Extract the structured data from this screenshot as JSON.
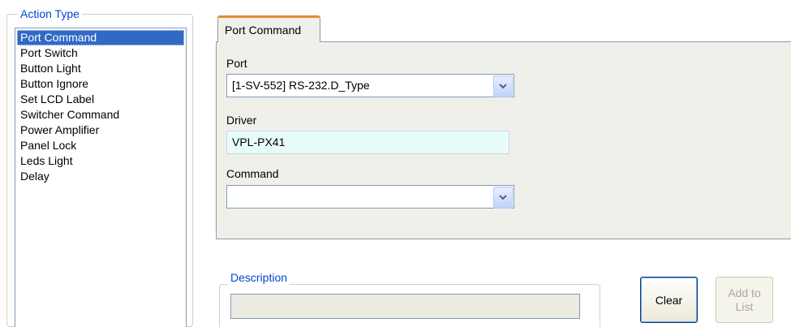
{
  "action_type": {
    "legend": "Action Type",
    "items": [
      "Port Command",
      "Port Switch",
      "Button Light",
      "Button Ignore",
      "Set LCD Label",
      "Switcher Command",
      "Power Amplifier",
      "Panel Lock",
      "Leds Light",
      "Delay"
    ],
    "selected": "Port Command"
  },
  "tabs": [
    "Port Command"
  ],
  "form": {
    "port_label": "Port",
    "port_value": "[1-SV-552] RS-232.D_Type",
    "driver_label": "Driver",
    "driver_value": "VPL-PX41",
    "command_label": "Command",
    "command_value": ""
  },
  "description": {
    "legend": "Description",
    "value": ""
  },
  "buttons": {
    "clear": "Clear",
    "add_line1": "Add to",
    "add_line2": "List"
  },
  "colors": {
    "legend_text": "#0046d5",
    "selection": "#316ac5",
    "tab_accent": "#e68b2c",
    "panel_bg": "#f0f0ea",
    "driver_bg": "#e8fbfb"
  }
}
